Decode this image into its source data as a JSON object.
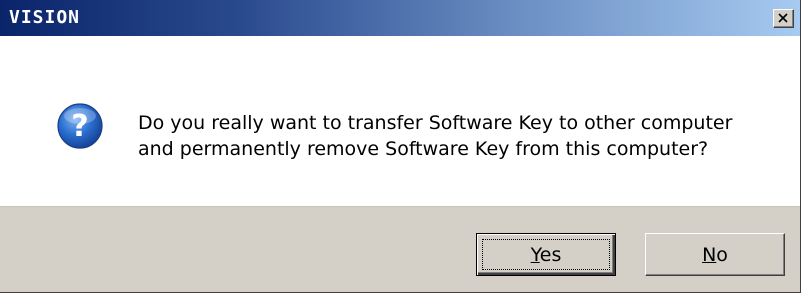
{
  "window": {
    "title": "VISION"
  },
  "message": {
    "line1": "Do you really want to transfer Software Key to other computer",
    "line2": "and permanently remove Software Key from this computer?",
    "icon": "question-icon"
  },
  "buttons": {
    "yes": {
      "mnemonic": "Y",
      "rest": "es"
    },
    "no": {
      "mnemonic": "N",
      "rest": "o"
    }
  },
  "colors": {
    "titlebar_start": "#0a246a",
    "titlebar_end": "#a6caf0",
    "footer": "#d4d0c8",
    "icon_blue": "#1f5fbf"
  }
}
